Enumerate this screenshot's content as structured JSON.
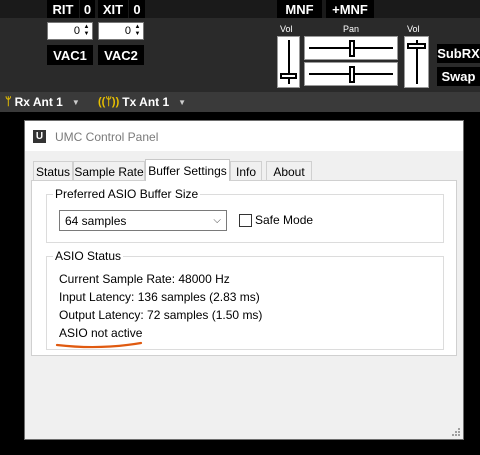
{
  "radio": {
    "rit_label": "RIT",
    "rit_value": "0",
    "xit_label": "XIT",
    "xit_value": "0",
    "rit_offset": "0",
    "xit_offset": "0",
    "vac1_label": "VAC1",
    "vac2_label": "VAC2",
    "mnf_label": "MNF",
    "plus_mnf_label": "+MNF",
    "vol_left_label": "Vol",
    "pan_label": "Pan",
    "vol_right_label": "Vol",
    "subrx_label": "SubRX",
    "swap_label": "Swap",
    "rx_ant_label": "Rx Ant 1",
    "tx_ant_label": "Tx Ant 1"
  },
  "dialog": {
    "title": "UMC Control Panel",
    "icon_letter": "U",
    "tabs": [
      {
        "label": "Status"
      },
      {
        "label": "Sample Rate"
      },
      {
        "label": "Buffer Settings"
      },
      {
        "label": "Info"
      },
      {
        "label": "About"
      }
    ],
    "active_tab": "Buffer Settings",
    "buffer_group_label": "Preferred ASIO Buffer Size",
    "buffer_select_value": "64 samples",
    "safe_mode_label": "Safe Mode",
    "safe_mode_checked": false,
    "status_group_label": "ASIO Status",
    "current_sample_rate": "Current Sample Rate: 48000 Hz",
    "input_latency": "Input Latency: 136 samples (2.83 ms)",
    "output_latency": "Output Latency: 72 samples (1.50 ms)",
    "asio_state": "ASIO not active"
  },
  "colors": {
    "annotation_underline": "#e05a10",
    "antenna_icon": "#e8c000"
  }
}
